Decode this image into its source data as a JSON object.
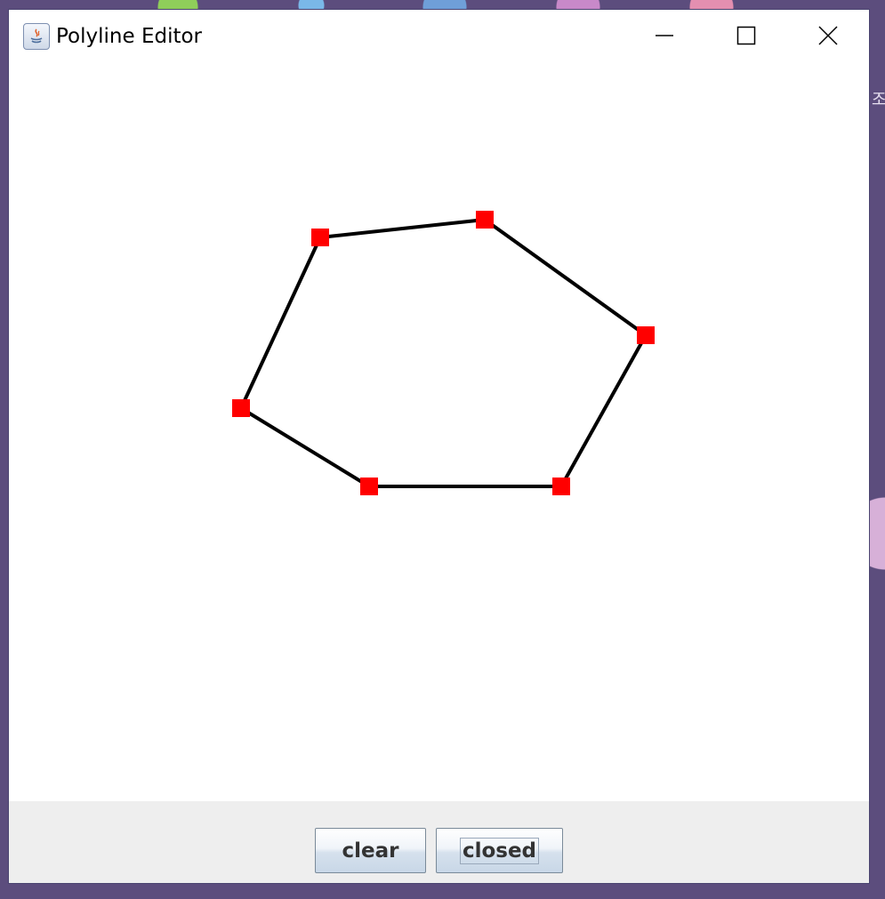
{
  "window": {
    "title": "Polyline Editor"
  },
  "desktop": {
    "visible_text": "조"
  },
  "colors": {
    "line": "#000000",
    "vertex": "#ff0000",
    "canvas_bg": "#ffffff",
    "panel_bg": "#eeeeee"
  },
  "polyline": {
    "closed": true,
    "vertex_count": 6
  },
  "buttons": {
    "clear_label": "clear",
    "closed_label": "closed"
  },
  "icons": {
    "app": "java-app-icon",
    "minimize": "minimize-icon",
    "maximize": "maximize-icon",
    "close": "close-icon"
  }
}
